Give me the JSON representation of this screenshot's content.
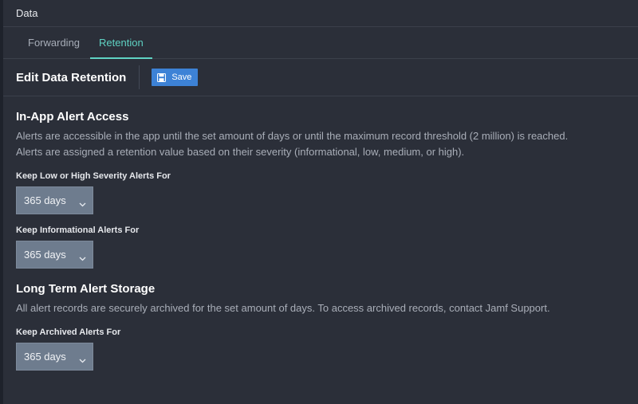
{
  "header": {
    "title": "Data"
  },
  "tabs": [
    {
      "label": "Forwarding"
    },
    {
      "label": "Retention"
    }
  ],
  "toolbar": {
    "title": "Edit Data Retention",
    "save_label": "Save"
  },
  "in_app": {
    "title": "In-App Alert Access",
    "desc1": "Alerts are accessible in the app until the set amount of days or until the maximum record threshold (2 million) is reached.",
    "desc2": "Alerts are assigned a retention value based on their severity (informational, low, medium, or high).",
    "fields": [
      {
        "label": "Keep Low or High Severity Alerts For",
        "value": "365 days"
      },
      {
        "label": "Keep Informational Alerts For",
        "value": "365 days"
      }
    ]
  },
  "long_term": {
    "title": "Long Term Alert Storage",
    "desc": "All alert records are securely archived for the set amount of days. To access archived records, contact Jamf Support.",
    "field": {
      "label": "Keep Archived Alerts For",
      "value": "365 days"
    }
  },
  "colors": {
    "accent": "#5fd2c3",
    "save_button": "#3d82d6",
    "background": "#2b2f39",
    "select_bg": "#6e7c8e"
  },
  "icons": {
    "save": "floppy-disk-icon",
    "dropdown": "chevron-down-icon"
  }
}
